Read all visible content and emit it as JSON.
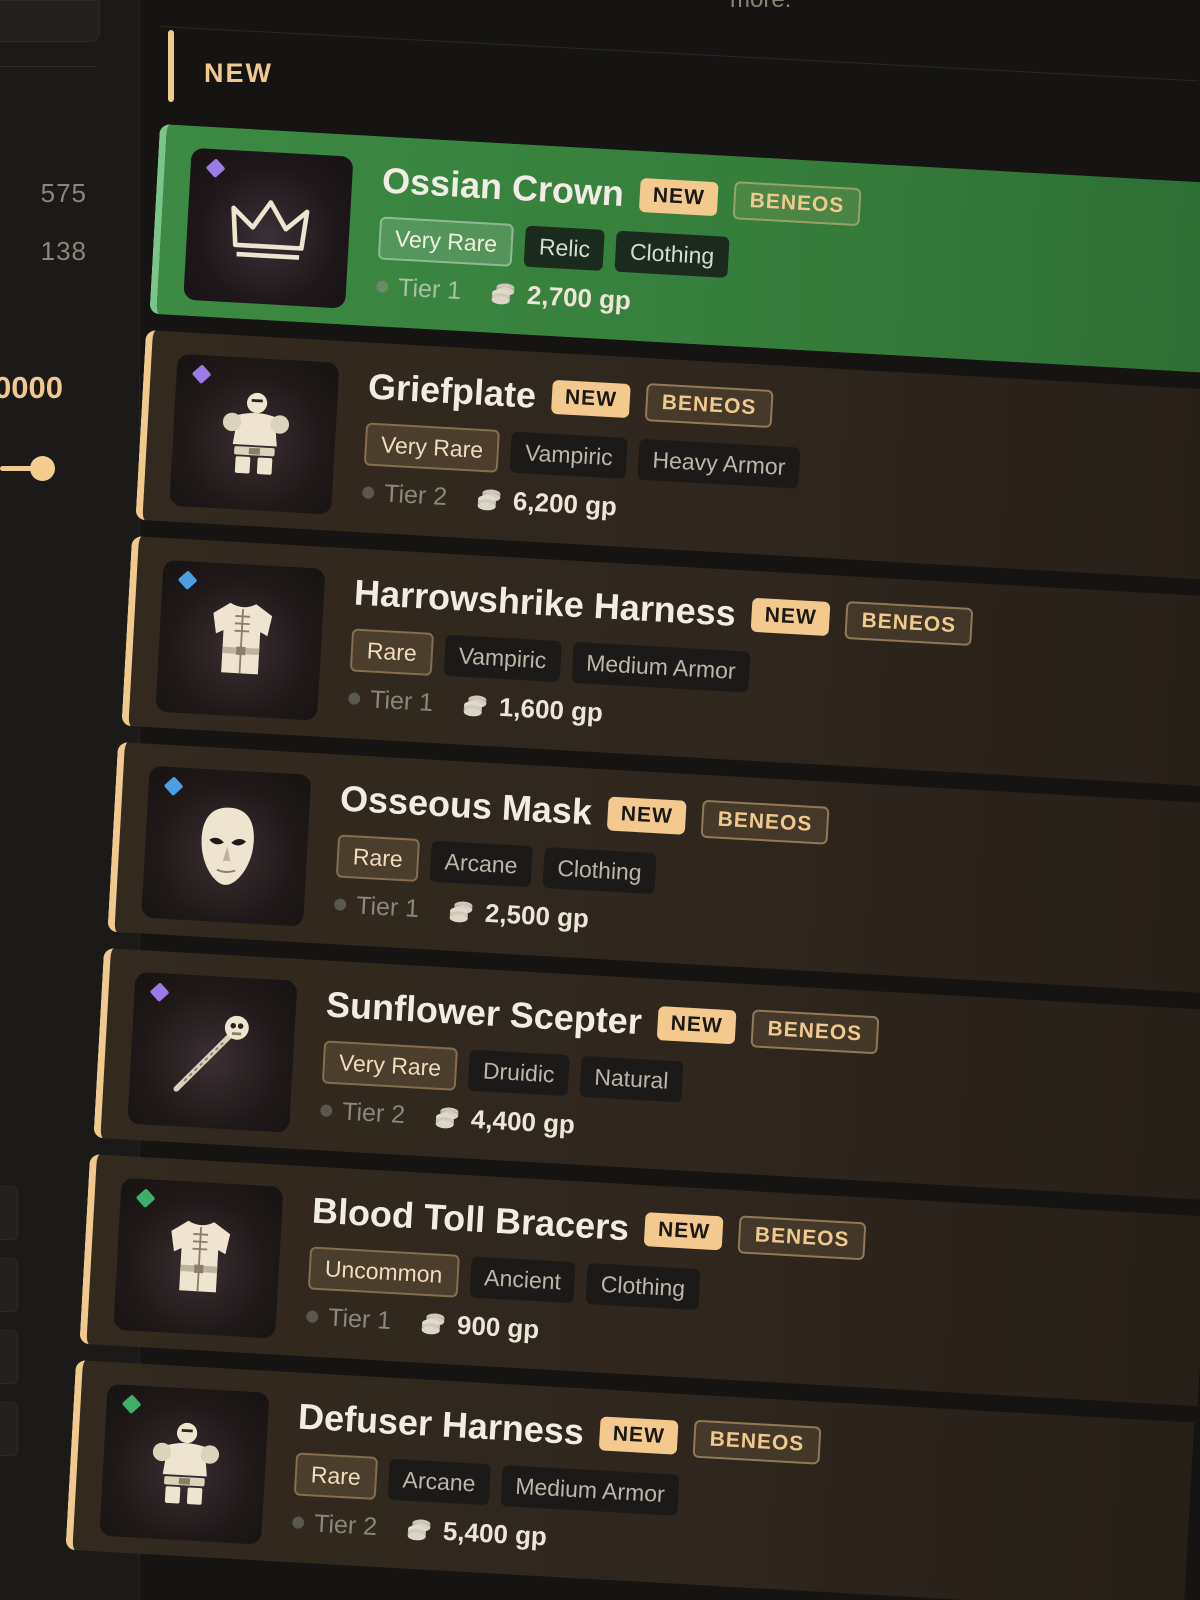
{
  "sidebar": {
    "counts": [
      "575",
      "138"
    ],
    "range_value": "0000"
  },
  "header": {
    "partial_text": "more.",
    "section_title": "NEW"
  },
  "colors": {
    "accent": "#f0c98e",
    "selected_row": "#3c8a43",
    "rarity_very_rare": "#9d7be6",
    "rarity_rare": "#4aa0e0",
    "rarity_uncommon": "#3fae6a"
  },
  "items": [
    {
      "name": "Ossian Crown",
      "new_label": "NEW",
      "source": "BENEOS",
      "rarity": "Very Rare",
      "tags": [
        "Relic",
        "Clothing"
      ],
      "tier": "Tier 1",
      "price": "2,700 gp",
      "icon": "crown-icon",
      "gem": "purple",
      "selected": true
    },
    {
      "name": "Griefplate",
      "new_label": "NEW",
      "source": "BENEOS",
      "rarity": "Very Rare",
      "tags": [
        "Vampiric",
        "Heavy Armor"
      ],
      "tier": "Tier 2",
      "price": "6,200 gp",
      "icon": "plate-armor-icon",
      "gem": "purple",
      "selected": false
    },
    {
      "name": "Harrowshrike Harness",
      "new_label": "NEW",
      "source": "BENEOS",
      "rarity": "Rare",
      "tags": [
        "Vampiric",
        "Medium Armor"
      ],
      "tier": "Tier 1",
      "price": "1,600 gp",
      "icon": "vest-armor-icon",
      "gem": "blue",
      "selected": false
    },
    {
      "name": "Osseous Mask",
      "new_label": "NEW",
      "source": "BENEOS",
      "rarity": "Rare",
      "tags": [
        "Arcane",
        "Clothing"
      ],
      "tier": "Tier 1",
      "price": "2,500 gp",
      "icon": "mask-icon",
      "gem": "blue",
      "selected": false
    },
    {
      "name": "Sunflower Scepter",
      "new_label": "NEW",
      "source": "BENEOS",
      "rarity": "Very Rare",
      "tags": [
        "Druidic",
        "Natural"
      ],
      "tier": "Tier 2",
      "price": "4,400 gp",
      "icon": "scepter-icon",
      "gem": "purple",
      "selected": false
    },
    {
      "name": "Blood Toll Bracers",
      "new_label": "NEW",
      "source": "BENEOS",
      "rarity": "Uncommon",
      "tags": [
        "Ancient",
        "Clothing"
      ],
      "tier": "Tier 1",
      "price": "900 gp",
      "icon": "vest-armor-icon",
      "gem": "green",
      "selected": false
    },
    {
      "name": "Defuser Harness",
      "new_label": "NEW",
      "source": "BENEOS",
      "rarity": "Rare",
      "tags": [
        "Arcane",
        "Medium Armor"
      ],
      "tier": "Tier 2",
      "price": "5,400 gp",
      "icon": "plate-armor-icon",
      "gem": "green",
      "selected": false
    }
  ]
}
